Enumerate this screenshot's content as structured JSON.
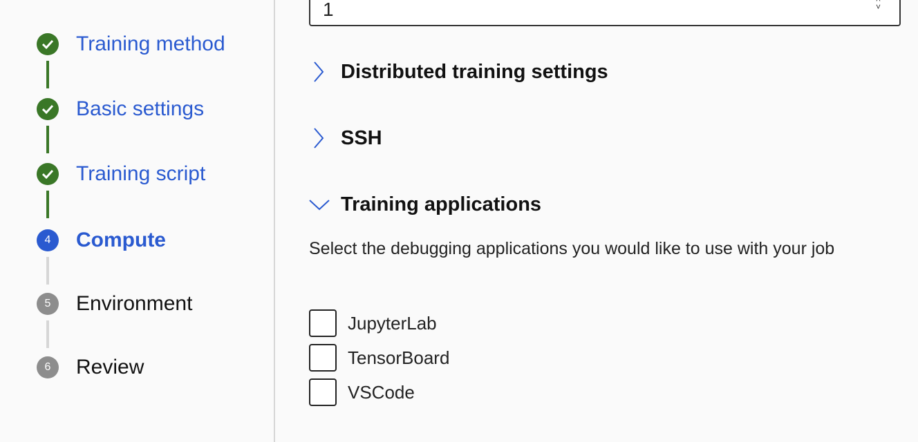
{
  "colors": {
    "done": "#3a7727",
    "current": "#2a5ad0",
    "pending": "#8d8d8d",
    "link": "#2a5ad0"
  },
  "steps": [
    {
      "label": "Training method",
      "status": "done",
      "icon": "check-icon"
    },
    {
      "label": "Basic settings",
      "status": "done",
      "icon": "check-icon"
    },
    {
      "label": "Training script",
      "status": "done",
      "icon": "check-icon"
    },
    {
      "label": "Compute",
      "status": "current",
      "number": "4"
    },
    {
      "label": "Environment",
      "status": "pending",
      "number": "5"
    },
    {
      "label": "Review",
      "status": "pending",
      "number": "6"
    }
  ],
  "main": {
    "input_value": "1",
    "sections": [
      {
        "title": "Distributed training settings",
        "expanded": false
      },
      {
        "title": "SSH",
        "expanded": false
      },
      {
        "title": "Training applications",
        "expanded": true
      }
    ],
    "description": "Select the debugging applications you would like to use with your job",
    "apps": [
      {
        "label": "JupyterLab",
        "checked": false
      },
      {
        "label": "TensorBoard",
        "checked": false
      },
      {
        "label": "VSCode",
        "checked": false
      }
    ]
  }
}
